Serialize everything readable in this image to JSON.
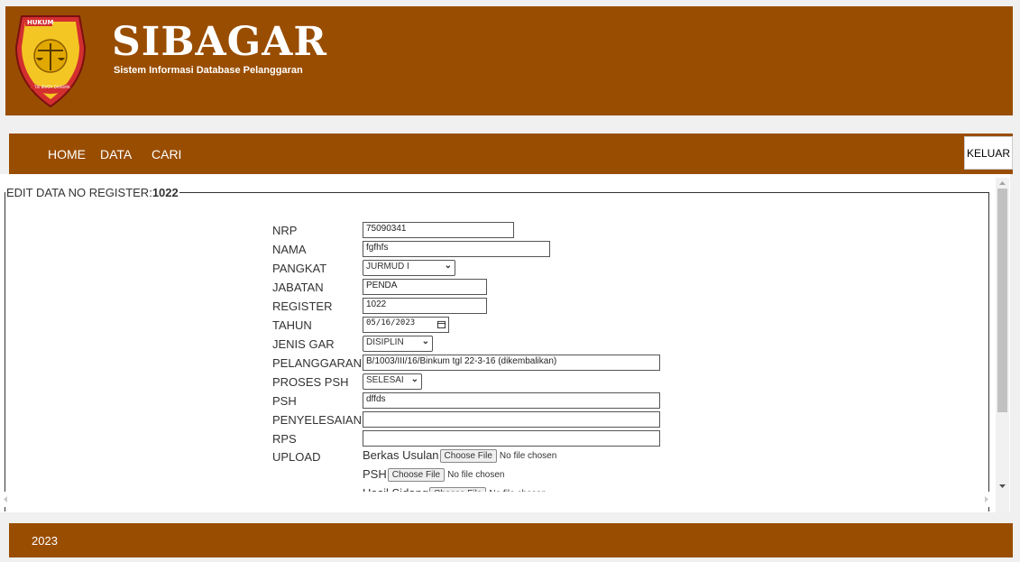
{
  "header": {
    "title": "SIBAGAR",
    "subtitle": "Sistem Informasi Database Pelanggaran",
    "logo": {
      "top_text": "HUKUM",
      "bottom_text": "TRI BRATA DHARMA"
    }
  },
  "nav": {
    "items": [
      {
        "label": "HOME"
      },
      {
        "label": "DATA"
      },
      {
        "label": "CARI"
      }
    ],
    "logout_label": "KELUAR"
  },
  "form": {
    "legend_prefix": "EDIT DATA NO REGISTER:",
    "register_no": "1022",
    "fields": {
      "nrp": {
        "label": "NRP",
        "value": "75090341"
      },
      "nama": {
        "label": "NAMA",
        "value": "fgfhfs"
      },
      "pangkat": {
        "label": "PANGKAT",
        "value": "JURMUD I"
      },
      "jabatan": {
        "label": "JABATAN",
        "value": "PENDA"
      },
      "register": {
        "label": "REGISTER",
        "value": "1022"
      },
      "tahun": {
        "label": "TAHUN",
        "value": "05/16/2023"
      },
      "jenis_gar": {
        "label": "JENIS GAR",
        "value": "DISIPLIN"
      },
      "pelanggaran": {
        "label": "PELANGGARAN",
        "value": "B/1003/III/16/Binkum  tgl 22-3-16 (dikembalikan)"
      },
      "proses_psh": {
        "label": "PROSES PSH",
        "value": "SELESAI"
      },
      "psh": {
        "label": "PSH",
        "value": "dffds"
      },
      "penyelesaian": {
        "label": "PENYELESAIAN",
        "value": ""
      },
      "rps": {
        "label": "RPS",
        "value": ""
      }
    },
    "upload": {
      "label": "UPLOAD",
      "items": [
        {
          "label": "Berkas Usulan",
          "button": "Choose File",
          "status": "No file chosen"
        },
        {
          "label": "PSH",
          "button": "Choose File",
          "status": "No file chosen"
        },
        {
          "label": "Hasil Sidang",
          "button": "Choose File",
          "status": "No file chosen"
        }
      ]
    }
  },
  "footer": {
    "text": "2023"
  },
  "colors": {
    "brand": "#994d00",
    "background": "#f0f0f0"
  },
  "icons": {
    "calendar": "calendar-icon",
    "chevron": "chevron-down-icon"
  }
}
